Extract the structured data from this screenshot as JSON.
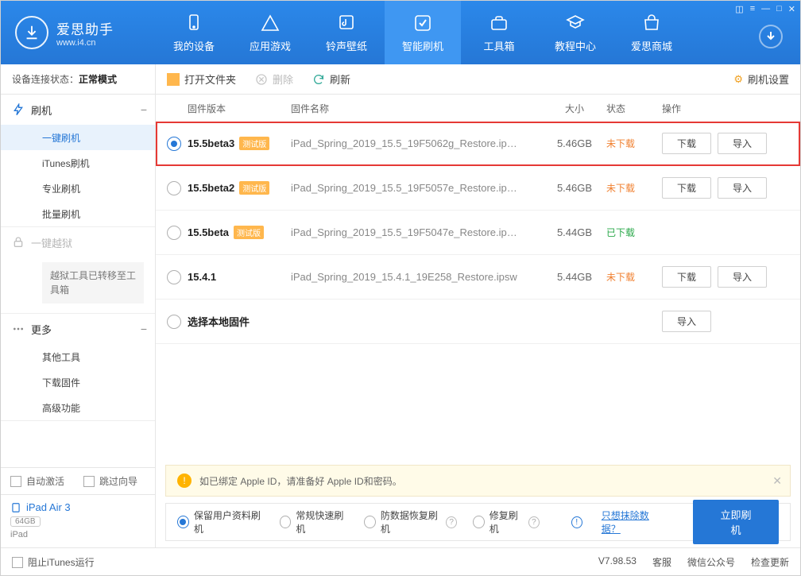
{
  "header": {
    "app_name": "爱思助手",
    "url": "www.i4.cn",
    "nav": [
      {
        "label": "我的设备"
      },
      {
        "label": "应用游戏"
      },
      {
        "label": "铃声壁纸"
      },
      {
        "label": "智能刷机",
        "active": true
      },
      {
        "label": "工具箱"
      },
      {
        "label": "教程中心"
      },
      {
        "label": "爱思商城"
      }
    ]
  },
  "sidebar": {
    "status_label": "设备连接状态：",
    "status_value": "正常模式",
    "groups": {
      "flash": {
        "title": "刷机",
        "items": [
          "一键刷机",
          "iTunes刷机",
          "专业刷机",
          "批量刷机"
        ]
      },
      "jb": {
        "title": "一键越狱",
        "note": "越狱工具已转移至工具箱"
      },
      "more": {
        "title": "更多",
        "items": [
          "其他工具",
          "下载固件",
          "高级功能"
        ]
      }
    },
    "auto_activate": "自动激活",
    "skip_guide": "跳过向导",
    "device": {
      "name": "iPad Air 3",
      "capacity": "64GB",
      "model": "iPad"
    }
  },
  "toolbar": {
    "open_folder": "打开文件夹",
    "delete": "删除",
    "refresh": "刷新",
    "settings": "刷机设置"
  },
  "columns": {
    "version": "固件版本",
    "name": "固件名称",
    "size": "大小",
    "status": "状态",
    "action": "操作"
  },
  "rows": [
    {
      "version": "15.5beta3",
      "beta": "测试版",
      "name": "iPad_Spring_2019_15.5_19F5062g_Restore.ip…",
      "size": "5.46GB",
      "status": "未下载",
      "status_cls": "un",
      "selected": true,
      "download": true,
      "import": true
    },
    {
      "version": "15.5beta2",
      "beta": "测试版",
      "name": "iPad_Spring_2019_15.5_19F5057e_Restore.ip…",
      "size": "5.46GB",
      "status": "未下载",
      "status_cls": "un",
      "download": true,
      "import": true
    },
    {
      "version": "15.5beta",
      "beta": "测试版",
      "name": "iPad_Spring_2019_15.5_19F5047e_Restore.ip…",
      "size": "5.44GB",
      "status": "已下载",
      "status_cls": "dn",
      "download": false,
      "import": false
    },
    {
      "version": "15.4.1",
      "beta": "",
      "name": "iPad_Spring_2019_15.4.1_19E258_Restore.ipsw",
      "size": "5.44GB",
      "status": "未下载",
      "status_cls": "un",
      "download": true,
      "import": true
    },
    {
      "version": "选择本地固件",
      "beta": "",
      "name": "",
      "size": "",
      "status": "",
      "status_cls": "",
      "download": false,
      "import": true
    }
  ],
  "buttons": {
    "download": "下载",
    "import": "导入"
  },
  "notice": "如已绑定 Apple ID，请准备好 Apple ID和密码。",
  "modes": {
    "keep": "保留用户资料刷机",
    "normal": "常规快速刷机",
    "anti": "防数据恢复刷机",
    "repair": "修复刷机",
    "erase_link": "只想抹除数据？",
    "go": "立即刷机"
  },
  "status": {
    "block_itunes": "阻止iTunes运行",
    "version": "V7.98.53",
    "support": "客服",
    "wechat": "微信公众号",
    "check_update": "检查更新"
  }
}
